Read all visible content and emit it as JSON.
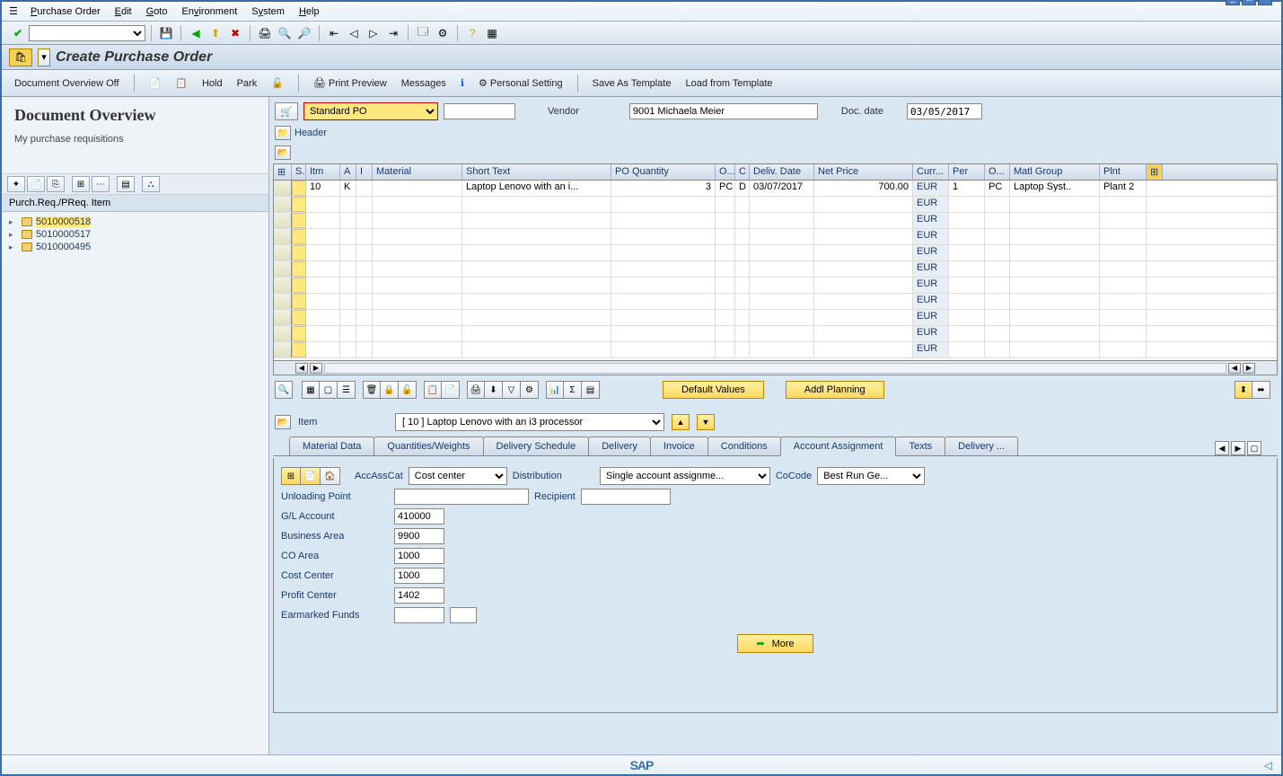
{
  "menubar": [
    "Purchase Order",
    "Edit",
    "Goto",
    "Environment",
    "System",
    "Help"
  ],
  "title": "Create Purchase Order",
  "apptoolbar": {
    "doc_overview": "Document Overview Off",
    "hold": "Hold",
    "park": "Park",
    "print_preview": "Print Preview",
    "messages": "Messages",
    "personal_setting": "Personal Setting",
    "save_template": "Save As Template",
    "load_template": "Load from Template"
  },
  "sidebar": {
    "title": "Document Overview",
    "subtitle": "My purchase requisitions",
    "tree_header": "Purch.Req./PReq. Item",
    "items": [
      {
        "num": "5010000518",
        "selected": true
      },
      {
        "num": "5010000517",
        "selected": false
      },
      {
        "num": "5010000495",
        "selected": false
      }
    ]
  },
  "po_header": {
    "type": "Standard PO",
    "vendor_label": "Vendor",
    "vendor": "9001 Michaela Meier",
    "doc_date_label": "Doc. date",
    "doc_date": "03/05/2017"
  },
  "header_section": "Header",
  "grid": {
    "columns": [
      "S..",
      "Itm",
      "A",
      "I",
      "Material",
      "Short Text",
      "PO Quantity",
      "O...",
      "C",
      "Deliv. Date",
      "Net Price",
      "Curr...",
      "Per",
      "O...",
      "Matl Group",
      "Plnt"
    ],
    "rows": [
      {
        "itm": "10",
        "a": "K",
        "short_text": "Laptop Lenovo with an i...",
        "qty": "3",
        "ou": "PC",
        "c": "D",
        "deliv": "03/07/2017",
        "price": "700.00",
        "curr": "EUR",
        "per": "1",
        "ou2": "PC",
        "mg": "Laptop Syst..",
        "plnt": "Plant 2"
      }
    ],
    "empty_curr": "EUR"
  },
  "grid_actions": {
    "default_values": "Default Values",
    "addl_planning": "Addl Planning"
  },
  "item": {
    "label": "Item",
    "value": "[ 10 ] Laptop Lenovo with an i3 processor"
  },
  "tabs": [
    "Material Data",
    "Quantities/Weights",
    "Delivery Schedule",
    "Delivery",
    "Invoice",
    "Conditions",
    "Account Assignment",
    "Texts",
    "Delivery ..."
  ],
  "active_tab": "Account Assignment",
  "account": {
    "acc_ass_cat_label": "AccAssCat",
    "acc_ass_cat": "Cost center",
    "distribution_label": "Distribution",
    "distribution": "Single account assignme...",
    "cocode_label": "CoCode",
    "cocode": "Best Run Ge...",
    "unloading_label": "Unloading Point",
    "recipient_label": "Recipient",
    "gl_label": "G/L Account",
    "gl": "410000",
    "ba_label": "Business Area",
    "ba": "9900",
    "co_label": "CO Area",
    "co": "1000",
    "cc_label": "Cost Center",
    "cc": "1000",
    "pc_label": "Profit Center",
    "pc": "1402",
    "ef_label": "Earmarked Funds",
    "more": "More"
  }
}
